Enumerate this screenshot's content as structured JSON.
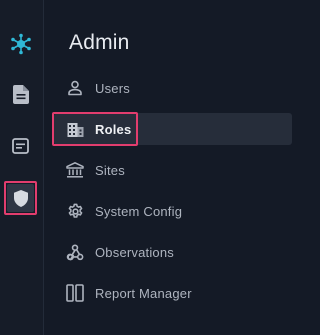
{
  "panel": {
    "title": "Admin"
  },
  "rail": {
    "items": [
      {
        "name": "app-logo-icon",
        "icon": "network-hub-icon"
      },
      {
        "name": "documents",
        "icon": "document-icon"
      },
      {
        "name": "notes",
        "icon": "note-card-icon"
      },
      {
        "name": "admin",
        "icon": "shield-icon",
        "selected": true
      }
    ]
  },
  "menu": {
    "items": [
      {
        "label": "Users",
        "icon": "user-icon"
      },
      {
        "label": "Roles",
        "icon": "building-icon",
        "active": true
      },
      {
        "label": "Sites",
        "icon": "bank-icon"
      },
      {
        "label": "System Config",
        "icon": "gear-icon"
      },
      {
        "label": "Observations",
        "icon": "webhook-icon"
      },
      {
        "label": "Report Manager",
        "icon": "report-panel-icon"
      }
    ]
  },
  "colors": {
    "background": "#141a26",
    "rail_background": "#161c28",
    "accent_cyan": "#2fb8d6",
    "highlight_pink": "#e23d6e",
    "active_item_bg": "#262d3a",
    "text_muted": "#aeb4bf",
    "text_bright": "#eef0f3"
  }
}
